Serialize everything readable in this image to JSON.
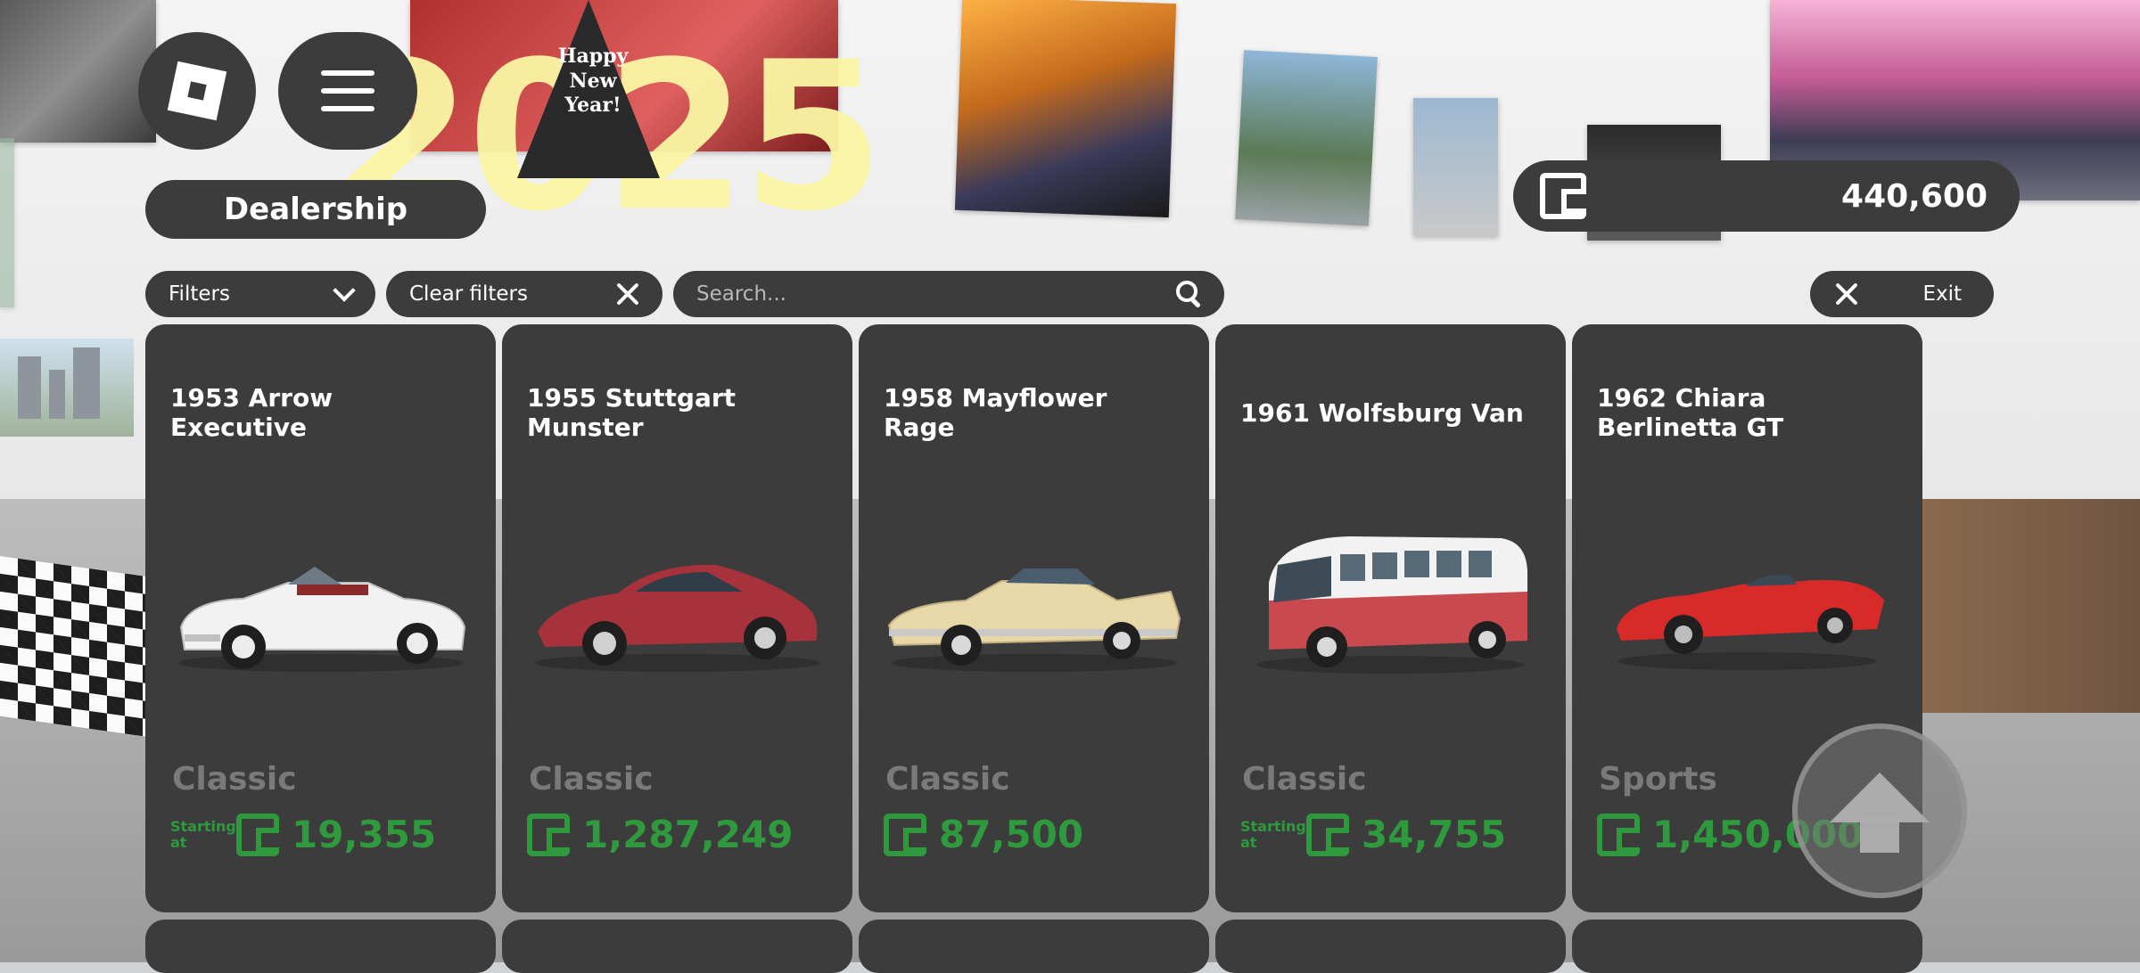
{
  "header": {
    "title": "Dealership",
    "currency_amount": "440,600"
  },
  "toolbar": {
    "filters_label": "Filters",
    "clear_filters_label": "Clear filters",
    "search_placeholder": "Search...",
    "exit_label": "Exit"
  },
  "cars": [
    {
      "name": "1953 Arrow Executive",
      "category": "Classic",
      "starting_label": "Starting at",
      "price": "19,355",
      "color": "#f2f2f2"
    },
    {
      "name": "1955 Stuttgart Munster",
      "category": "Classic",
      "starting_label": "",
      "price": "1,287,249",
      "color": "#a8323c"
    },
    {
      "name": "1958 Mayflower Rage",
      "category": "Classic",
      "starting_label": "",
      "price": "87,500",
      "color": "#e8d8a8"
    },
    {
      "name": "1961 Wolfsburg Van",
      "category": "Classic",
      "starting_label": "Starting at",
      "price": "34,755",
      "color": "#c8494e"
    },
    {
      "name": "1962 Chiara Berlinetta GT",
      "category": "Sports",
      "starting_label": "",
      "price": "1,450,000",
      "color": "#d92a2a"
    }
  ],
  "backdrop": {
    "decor_text": "2025",
    "hat_text": "Happy New Year!"
  },
  "colors": {
    "panel": "#3c3c3c",
    "price_green": "#2e9a3d",
    "category_gray": "#7a7a7a"
  },
  "icons": {
    "roblox": "roblox-logo-icon",
    "menu": "hamburger-menu-icon",
    "currency": "wallet-icon",
    "search": "search-icon",
    "dropdown": "chevron-down-icon",
    "close": "close-icon",
    "jump": "up-arrow-icon"
  }
}
